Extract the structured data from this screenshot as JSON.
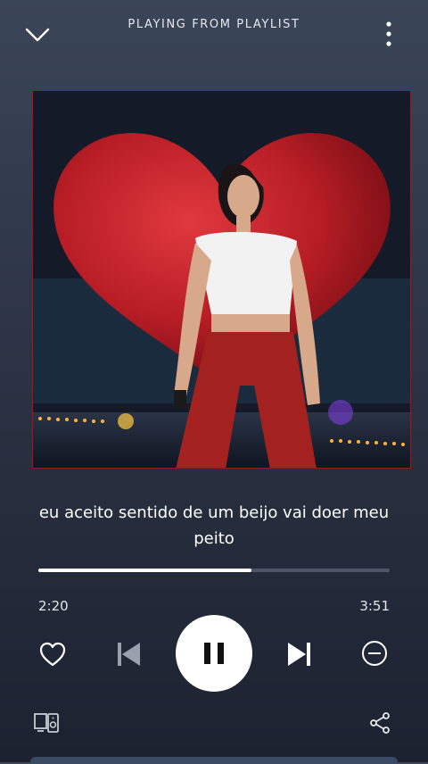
{
  "header": {
    "title": "PLAYING FROM PLAYLIST",
    "down_icon": "chevron-down-icon",
    "menu_icon": "more-vertical-icon"
  },
  "album_art": {
    "description_icon": "album-art-image"
  },
  "lyrics": {
    "line": "eu aceito sentido de um beijo vai doer meu peito"
  },
  "playback": {
    "current_time": "2:20",
    "total_time": "3:51",
    "progress_fraction": 0.606
  },
  "controls": {
    "like_icon": "heart-outline-icon",
    "previous_icon": "skip-previous-icon",
    "play_pause_icon": "pause-icon",
    "next_icon": "skip-next-icon",
    "remove_icon": "minus-circle-icon",
    "devices_icon": "connect-devices-icon",
    "share_icon": "share-icon"
  },
  "colors": {
    "background_top": "#3a4557",
    "background_bottom": "#1c2230",
    "progress_fill": "#ffffff",
    "progress_track": "#4d5566",
    "art_border": "#7a2430"
  }
}
